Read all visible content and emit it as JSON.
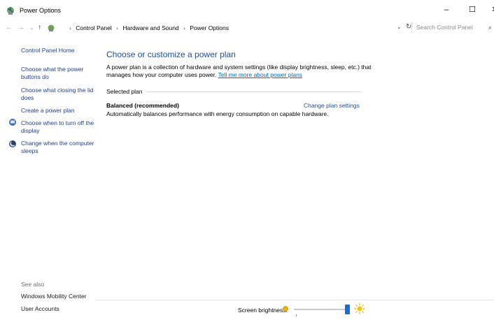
{
  "window": {
    "title": "Power Options",
    "minimize_glyph": "–",
    "maximize_glyph": "☐",
    "close_glyph": "✕"
  },
  "address_bar": {
    "breadcrumbs": [
      "Control Panel",
      "Hardware and Sound",
      "Power Options"
    ],
    "search_placeholder": "Search Control Panel"
  },
  "sidebar": {
    "items": [
      {
        "label": "Control Panel Home"
      },
      {
        "label": "Choose what the power buttons do"
      },
      {
        "label": "Choose what closing the lid does"
      },
      {
        "label": "Create a power plan"
      },
      {
        "label": "Choose when to turn off the display",
        "icon": "display-icon"
      },
      {
        "label": "Change when the computer sleeps",
        "icon": "moon-icon"
      }
    ],
    "see_also": {
      "title": "See also",
      "links": [
        "Windows Mobility Center",
        "User Accounts"
      ]
    }
  },
  "main": {
    "heading": "Choose or customize a power plan",
    "description": "A power plan is a collection of hardware and system settings (like display brightness, sleep, etc.) that manages how your computer uses power.",
    "learn_more_link": "Tell me more about power plans",
    "group_label": "Selected plan",
    "plan": {
      "name": "Balanced (recommended)",
      "change_link": "Change plan settings",
      "description": "Automatically balances performance with energy consumption on capable hardware."
    }
  },
  "footer": {
    "brightness_label": "Screen brightness:",
    "brightness_level": 1.0
  },
  "colors": {
    "link_blue": "#1e3f8f",
    "heading_blue": "#1c4d9b",
    "slider_thumb": "#1c6ad6"
  }
}
